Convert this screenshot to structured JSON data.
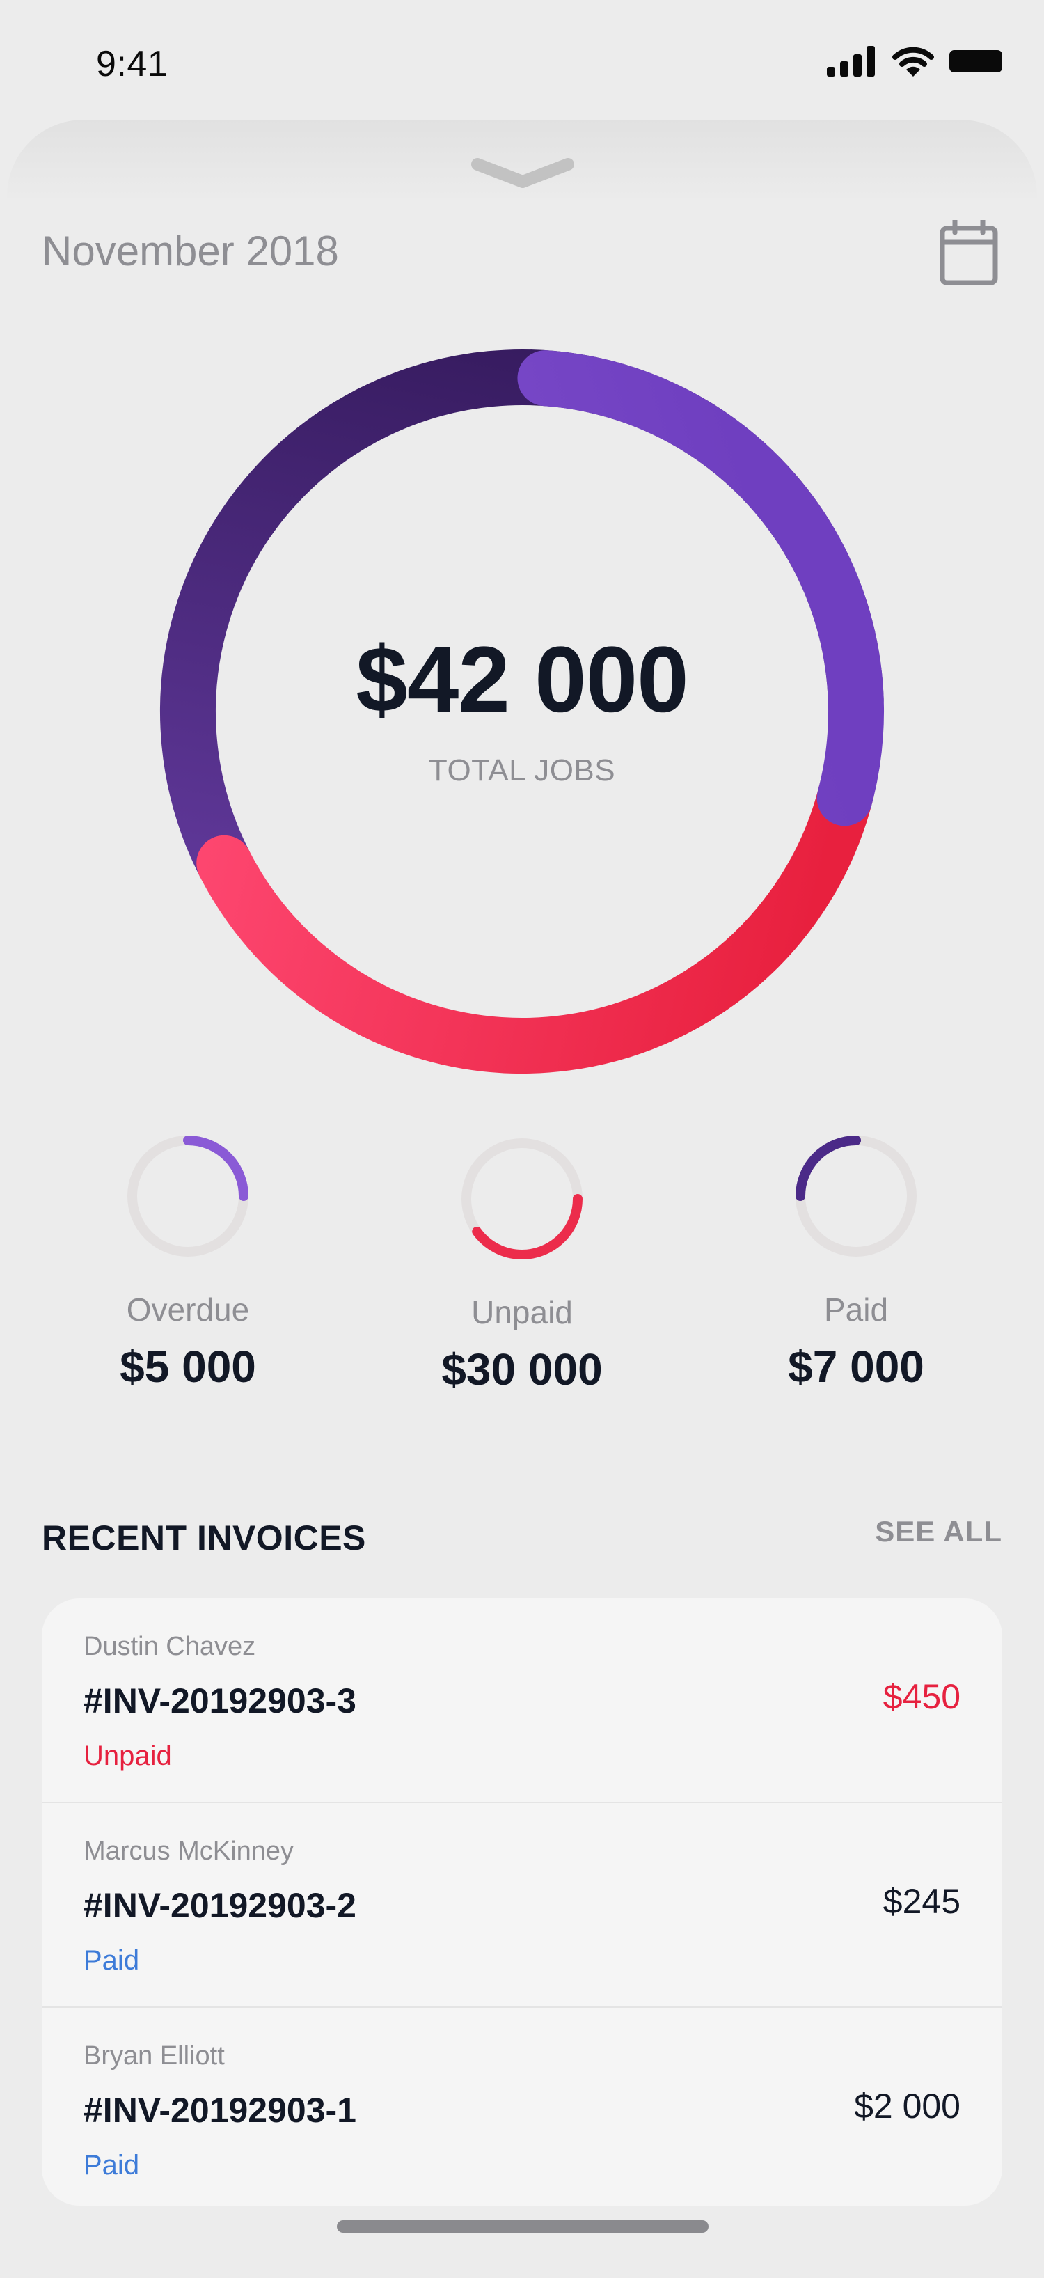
{
  "status_bar": {
    "time": "9:41",
    "icons": [
      "cellular-signal-icon",
      "wifi-icon",
      "battery-icon"
    ]
  },
  "header": {
    "month": "November 2018",
    "calendar_icon": "calendar-icon"
  },
  "summary": {
    "total_amount": "$42 000",
    "total_label": "TOTAL JOBS",
    "colors": {
      "overdue": "#8a5ad6",
      "paid": "#4b2a88",
      "unpaid": "#ec2c4b",
      "track": "#e3e0e0"
    }
  },
  "breakdown": [
    {
      "label": "Overdue",
      "amount": "$5 000",
      "share": 0.25
    },
    {
      "label": "Unpaid",
      "amount": "$30 000",
      "share": 0.4
    },
    {
      "label": "Paid",
      "amount": "$7 000",
      "share": 0.25
    }
  ],
  "recent_invoices": {
    "title": "RECENT INVOICES",
    "see_all": "SEE ALL",
    "items": [
      {
        "client": "Dustin Chavez",
        "number": "#INV-20192903-3",
        "status": "Unpaid",
        "amount": "$450"
      },
      {
        "client": "Marcus McKinney",
        "number": "#INV-20192903-2",
        "status": "Paid",
        "amount": "$245"
      },
      {
        "client": "Bryan Elliott",
        "number": "#INV-20192903-1",
        "status": "Paid",
        "amount": "$2 000"
      }
    ]
  }
}
